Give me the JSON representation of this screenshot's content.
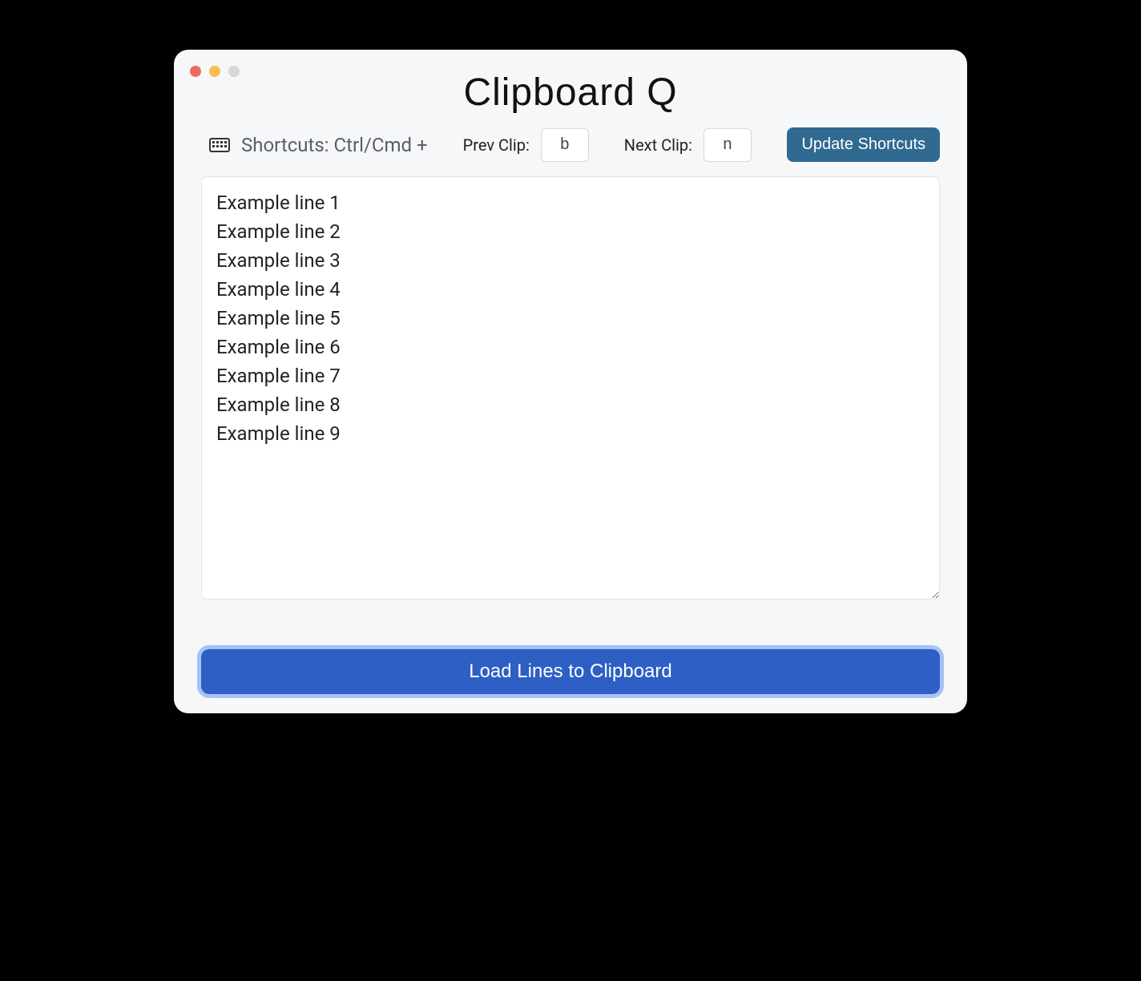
{
  "app": {
    "title": "Clipboard Q"
  },
  "shortcuts": {
    "label": "Shortcuts: Ctrl/Cmd +",
    "prev_label": "Prev Clip:",
    "prev_value": "b",
    "next_label": "Next Clip:",
    "next_value": "n",
    "update_label": "Update Shortcuts"
  },
  "textarea": {
    "lines": [
      "Example line 1",
      "Example line 2",
      "Example line 3",
      "Example line 4",
      "Example line 5",
      "Example line 6",
      "Example line 7",
      "Example line 8",
      "Example line 9"
    ]
  },
  "load_button": {
    "label": "Load Lines to Clipboard"
  }
}
